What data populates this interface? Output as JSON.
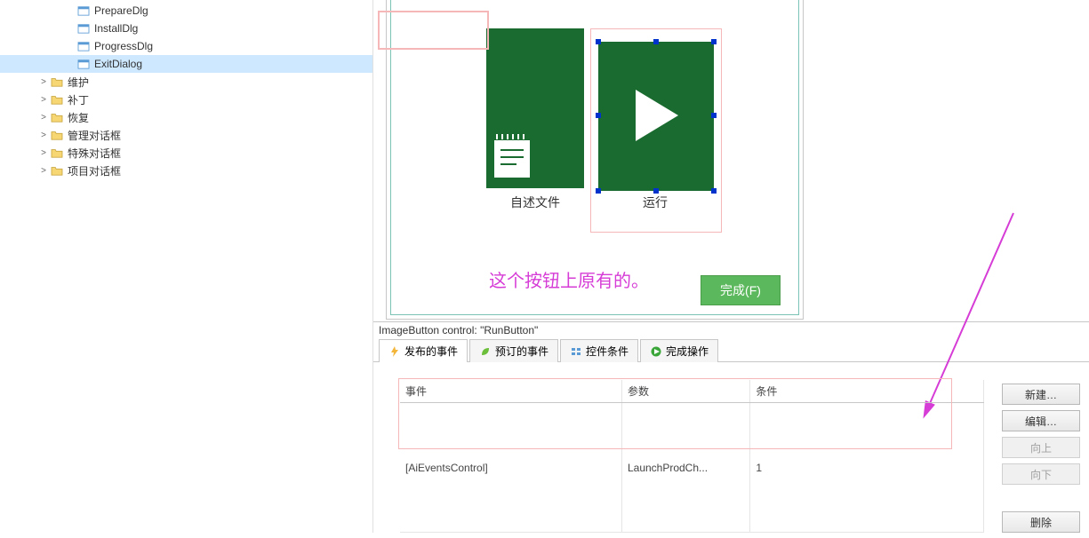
{
  "tree": {
    "items": [
      {
        "indent": 72,
        "toggle": "",
        "type": "dialog",
        "label": "PrepareDlg"
      },
      {
        "indent": 72,
        "toggle": "",
        "type": "dialog",
        "label": "InstallDlg"
      },
      {
        "indent": 72,
        "toggle": "",
        "type": "dialog",
        "label": "ProgressDlg"
      },
      {
        "indent": 72,
        "toggle": "",
        "type": "dialog",
        "label": "ExitDialog",
        "selected": true
      },
      {
        "indent": 42,
        "toggle": ">",
        "type": "folder",
        "label": "维护"
      },
      {
        "indent": 42,
        "toggle": ">",
        "type": "folder",
        "label": "补丁"
      },
      {
        "indent": 42,
        "toggle": ">",
        "type": "folder",
        "label": "恢复"
      },
      {
        "indent": 42,
        "toggle": ">",
        "type": "folder",
        "label": "管理对话框"
      },
      {
        "indent": 42,
        "toggle": ">",
        "type": "folder",
        "label": "特殊对话框"
      },
      {
        "indent": 42,
        "toggle": ">",
        "type": "folder",
        "label": "项目对话框"
      }
    ]
  },
  "designer": {
    "readme_caption": "自述文件",
    "run_caption": "运行",
    "finish_label": "完成(F)"
  },
  "annotation": {
    "text": "这个按钮上原有的。"
  },
  "bottom": {
    "control_label": "ImageButton control: \"RunButton\"",
    "tabs": [
      {
        "icon": "lightning",
        "label": "发布的事件",
        "active": true
      },
      {
        "icon": "leaf",
        "label": "预订的事件"
      },
      {
        "icon": "controls",
        "label": "控件条件"
      },
      {
        "icon": "play",
        "label": "完成操作"
      }
    ],
    "grid": {
      "headers": {
        "event": "事件",
        "param": "参数",
        "cond": "条件"
      },
      "rows": [
        {
          "event": "[AiEventsControl]",
          "param": "LaunchProdCh...",
          "cond": "1"
        }
      ]
    },
    "buttons": {
      "new": "新建…",
      "edit": "编辑…",
      "up": "向上",
      "down": "向下",
      "delete": "删除"
    }
  }
}
